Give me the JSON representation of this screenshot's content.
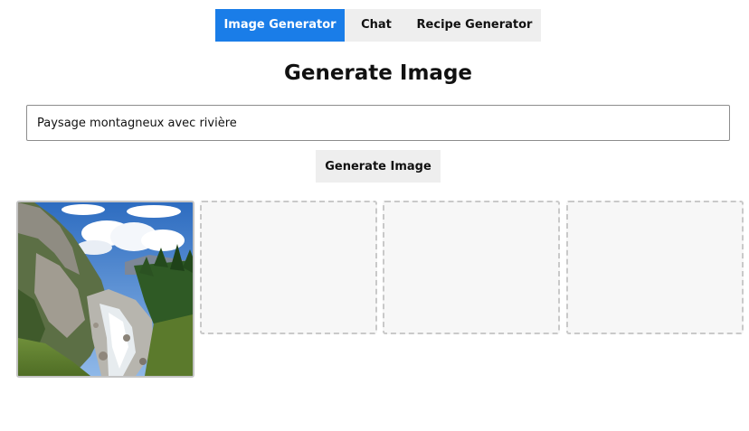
{
  "tabs": [
    {
      "label": "Image Generator",
      "active": true
    },
    {
      "label": "Chat",
      "active": false
    },
    {
      "label": "Recipe Generator",
      "active": false
    }
  ],
  "page": {
    "title": "Generate Image"
  },
  "prompt": {
    "value": "Paysage montagneux avec rivière"
  },
  "generate_button": {
    "label": "Generate Image"
  },
  "results": {
    "slots": [
      {
        "state": "filled",
        "content": "mountain-river-landscape"
      },
      {
        "state": "empty"
      },
      {
        "state": "empty"
      },
      {
        "state": "empty"
      }
    ]
  },
  "colors": {
    "accent": "#1a7de8",
    "tab_inactive": "#eeeeee",
    "button_bg": "#eeeeee",
    "slot_placeholder_bg": "#f7f7f7",
    "slot_border": "#c9c9c9"
  }
}
